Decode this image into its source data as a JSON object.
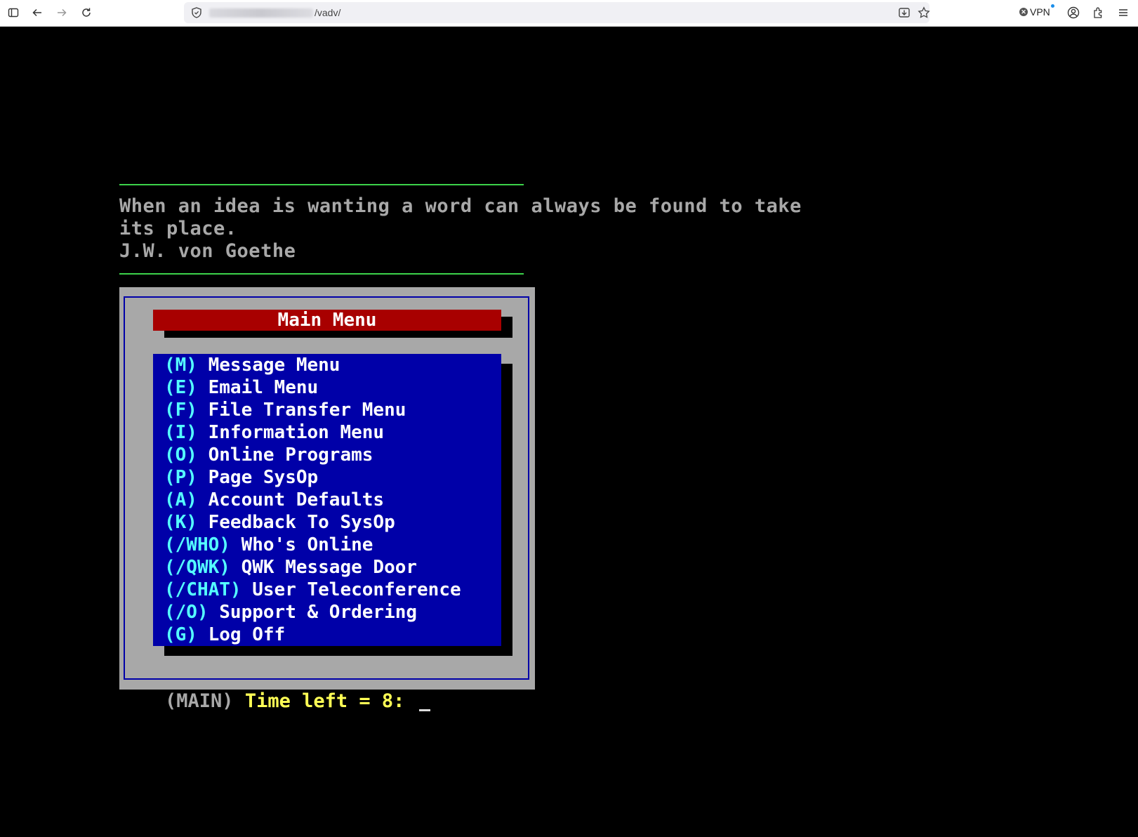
{
  "browser": {
    "url_path": "/vadv/",
    "vpn_label": "VPN"
  },
  "quote": {
    "line1": "When an idea is wanting a word can always be found to take",
    "line2": "its place.",
    "author": "J.W. von Goethe"
  },
  "menu": {
    "title": "Main Menu",
    "items": [
      {
        "key": "(M)",
        "label": " Message Menu"
      },
      {
        "key": "(E)",
        "label": " Email Menu"
      },
      {
        "key": "(F)",
        "label": " File Transfer Menu"
      },
      {
        "key": "(I)",
        "label": " Information Menu"
      },
      {
        "key": "(O)",
        "label": " Online Programs"
      },
      {
        "key": "(P)",
        "label": " Page SysOp"
      },
      {
        "key": "(A)",
        "label": " Account Defaults"
      },
      {
        "key": "(K)",
        "label": " Feedback To SysOp"
      },
      {
        "key": "(/WHO)",
        "label": " Who's Online"
      },
      {
        "key": "(/QWK)",
        "label": " QWK Message Door"
      },
      {
        "key": "(/CHAT)",
        "label": " User Teleconference"
      },
      {
        "key": "(/O)",
        "label": " Support & Ordering"
      },
      {
        "key": "(G)",
        "label": " Log Off"
      }
    ]
  },
  "prompt": {
    "context": "(MAIN)",
    "time_text": " Time left = 8: "
  },
  "colors": {
    "terminal_bg": "#000000",
    "rule_green": "#3cd24a",
    "menu_frame_gray": "#a8a8a8",
    "title_red": "#a80000",
    "items_blue": "#0000a8",
    "key_cyan": "#55ffff",
    "prompt_yellow": "#ffff55"
  }
}
